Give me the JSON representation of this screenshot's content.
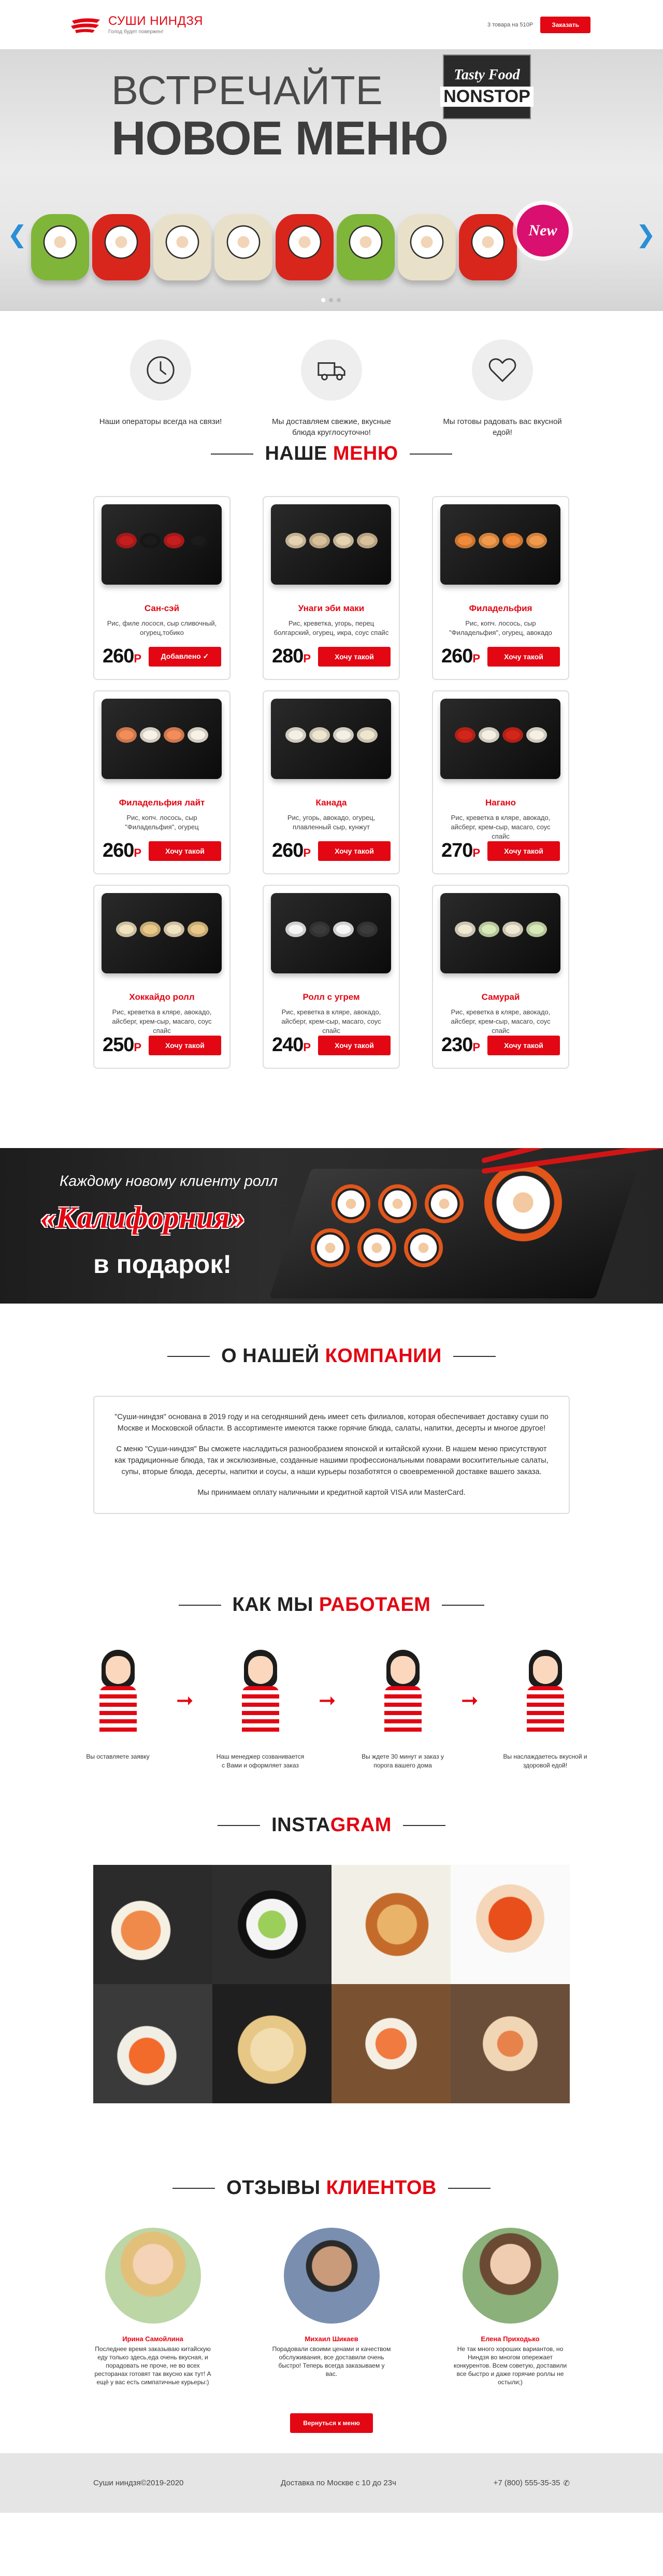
{
  "header": {
    "logo_title": "СУШИ НИНДЗЯ",
    "logo_subtitle": "Голод будет повержен!",
    "cart_info": "3 товара на 510Р",
    "order_button": "Заказать"
  },
  "hero": {
    "line1": "ВСТРЕЧАЙТЕ",
    "line2": "НОВОЕ МЕНЮ",
    "brand_1": "Tasty Food",
    "brand_2": "NONSTOP",
    "badge": "New"
  },
  "features": [
    {
      "icon": "clock-icon",
      "text": "Наши операторы всегда на связи!"
    },
    {
      "icon": "truck-icon",
      "text": "Мы доставляем свежие, вкусные блюда круглосуточно!"
    },
    {
      "icon": "heart-icon",
      "text": "Мы готовы радовать вас вкусной едой!"
    }
  ],
  "menu": {
    "title_a": "НАШЕ",
    "title_b": "МЕНЮ",
    "currency": "Р",
    "items": [
      {
        "name": "Сан-сэй",
        "desc": "Рис, филе лосося, сыр сливочный, огурец,тобико",
        "price": "260",
        "button": "Добавлено ✓"
      },
      {
        "name": "Унаги эби маки",
        "desc": "Рис, креветка, угорь, перец болгарский, огурец, икра, соус спайс",
        "price": "280",
        "button": "Хочу такой"
      },
      {
        "name": "Филадельфия",
        "desc": "Рис, копч. лосось, сыр \"Филадельфия\", огурец, авокадо",
        "price": "260",
        "button": "Хочу такой"
      },
      {
        "name": "Филадельфия лайт",
        "desc": "Рис, копч. лосось, сыр \"Филадельфия\", огурец",
        "price": "260",
        "button": "Хочу такой"
      },
      {
        "name": "Канада",
        "desc": "Рис, угорь, авокадо, огурец, плавленный сыр, кунжут",
        "price": "260",
        "button": "Хочу такой"
      },
      {
        "name": "Нагано",
        "desc": "Рис, креветка в кляре, авокадо, айсберг, крем-сыр, масаго, соус спайс",
        "price": "270",
        "button": "Хочу такой"
      },
      {
        "name": "Хоккайдо ролл",
        "desc": "Рис, креветка в кляре, авокадо, айсберг, крем-сыр, масаго, соус спайс",
        "price": "250",
        "button": "Хочу такой"
      },
      {
        "name": "Ролл с угрем",
        "desc": "Рис, креветка в кляре, авокадо, айсберг, крем-сыр, масаго, соус спайс",
        "price": "240",
        "button": "Хочу такой"
      },
      {
        "name": "Самурай",
        "desc": "Рис, креветка в кляре, авокадо, айсберг, крем-сыр, масаго, соус спайс",
        "price": "230",
        "button": "Хочу такой"
      }
    ]
  },
  "banner": {
    "line1": "Каждому новому клиенту ролл",
    "roll_name": "«Калифорния»",
    "line3": "в подарок!"
  },
  "about": {
    "title_a": "О НАШЕЙ",
    "title_b": "КОМПАНИИ",
    "p1": "\"Суши-ниндзя\" основана в 2019 году и на сегодняшний день имеет сеть филиалов, которая обеспечивает доставку суши по Москве и Московской области. В ассортименте имеются также горячие блюда, салаты, напитки, десерты и многое другое!",
    "p2": "С меню \"Суши-ниндзя\" Вы сможете насладиться разнообразием японской и китайской кухни. В нашем меню присутствуют как традиционные блюда, так и эксклюзивные, созданные нашими профессиональными поварами восхитительные салаты, супы, вторые блюда, десерты, напитки и соусы, а наши курьеры позаботятся о своевременной доставке вашего заказа.",
    "p3": "Мы принимаем оплату наличными и кредитной картой VISA или MasterCard."
  },
  "how": {
    "title_a": "КАК МЫ",
    "title_b": "РАБОТАЕМ",
    "steps": [
      "Вы оставляете заявку",
      "Наш менеджер созванивается с Вами и оформляет заказ",
      "Вы ждете 30 минут и заказ у порога вашего дома",
      "Вы наслаждаетесь вкусной и здоровой едой!"
    ]
  },
  "insta": {
    "title_a": "INSTA",
    "title_b": "GRAM"
  },
  "reviews": {
    "title_a": "ОТЗЫВЫ",
    "title_b": "КЛИЕНТОВ",
    "items": [
      {
        "name": "Ирина Самойлина",
        "text": "Последнее время заказываю китайскую еду только здесь,еда очень вкусная, и порадовать не проче, не во всех ресторанах готовят так вкусно как тут! А ещё у вас есть симпатичные курьеры:)"
      },
      {
        "name": "Михаил Шикаев",
        "text": "Порадовали своими ценами и качеством обслуживания, все доставили очень быстро! Теперь всегда заказываем у вас."
      },
      {
        "name": "Елена Приходько",
        "text": "Не так много хороших вариантов, но Ниндзя во многом опережает конкурентов. Всем советую, доставили все быстро и даже горячие роллы не остыли;)"
      }
    ],
    "back_button": "Вернуться к меню"
  },
  "footer": {
    "copyright": "Суши ниндзя©2019-2020",
    "delivery": "Доставка по Москве с 10 до 23ч",
    "phone": "+7 (800) 555-35-35"
  },
  "colors": {
    "accent": "#e30613",
    "footer_bg": "#e5e5e5",
    "dark_banner": "#1d1d1d"
  }
}
